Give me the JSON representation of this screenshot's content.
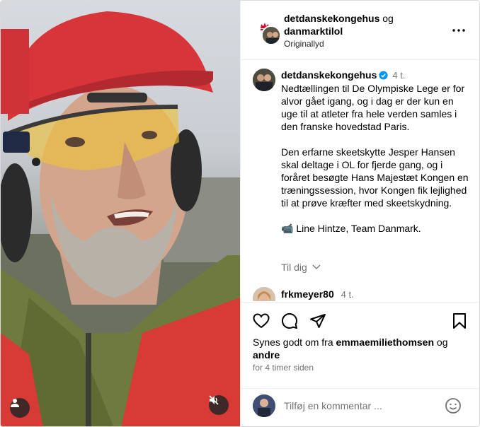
{
  "header": {
    "author": "detdanskekongehus",
    "joiner": "og",
    "coauthor": "danmarktilol",
    "audio": "Originallyd"
  },
  "caption": {
    "username": "detdanskekongehus",
    "time": "4 t.",
    "paragraphs": [
      "Nedtællingen til De Olympiske Lege er for alvor gået igang, og i dag er der kun en uge til at atleter fra hele verden samles i den franske hovedstad Paris.",
      "Den erfarne skeetskytte Jesper Hansen skal deltage i OL for fjerde gang, og i foråret besøgte Hans Majestæt Kongen en træningssession, hvor Kongen fik lejlighed til at prøve kræfter med skeetskydning.",
      "📹 Line Hintze, Team Danmark."
    ],
    "see_translation": "Til dig"
  },
  "comment": {
    "username": "frkmeyer80",
    "time": "4 t."
  },
  "likes": {
    "prefix": "Synes godt om fra",
    "user": "emmaemiliethomsen",
    "joiner": "og",
    "others": "andre"
  },
  "timestamp": "for 4 timer siden",
  "add_comment": {
    "placeholder": "Tilføj en kommentar ..."
  },
  "colors": {
    "verified": "#0095f6",
    "secondary_text": "#737373",
    "border": "#efefef"
  }
}
